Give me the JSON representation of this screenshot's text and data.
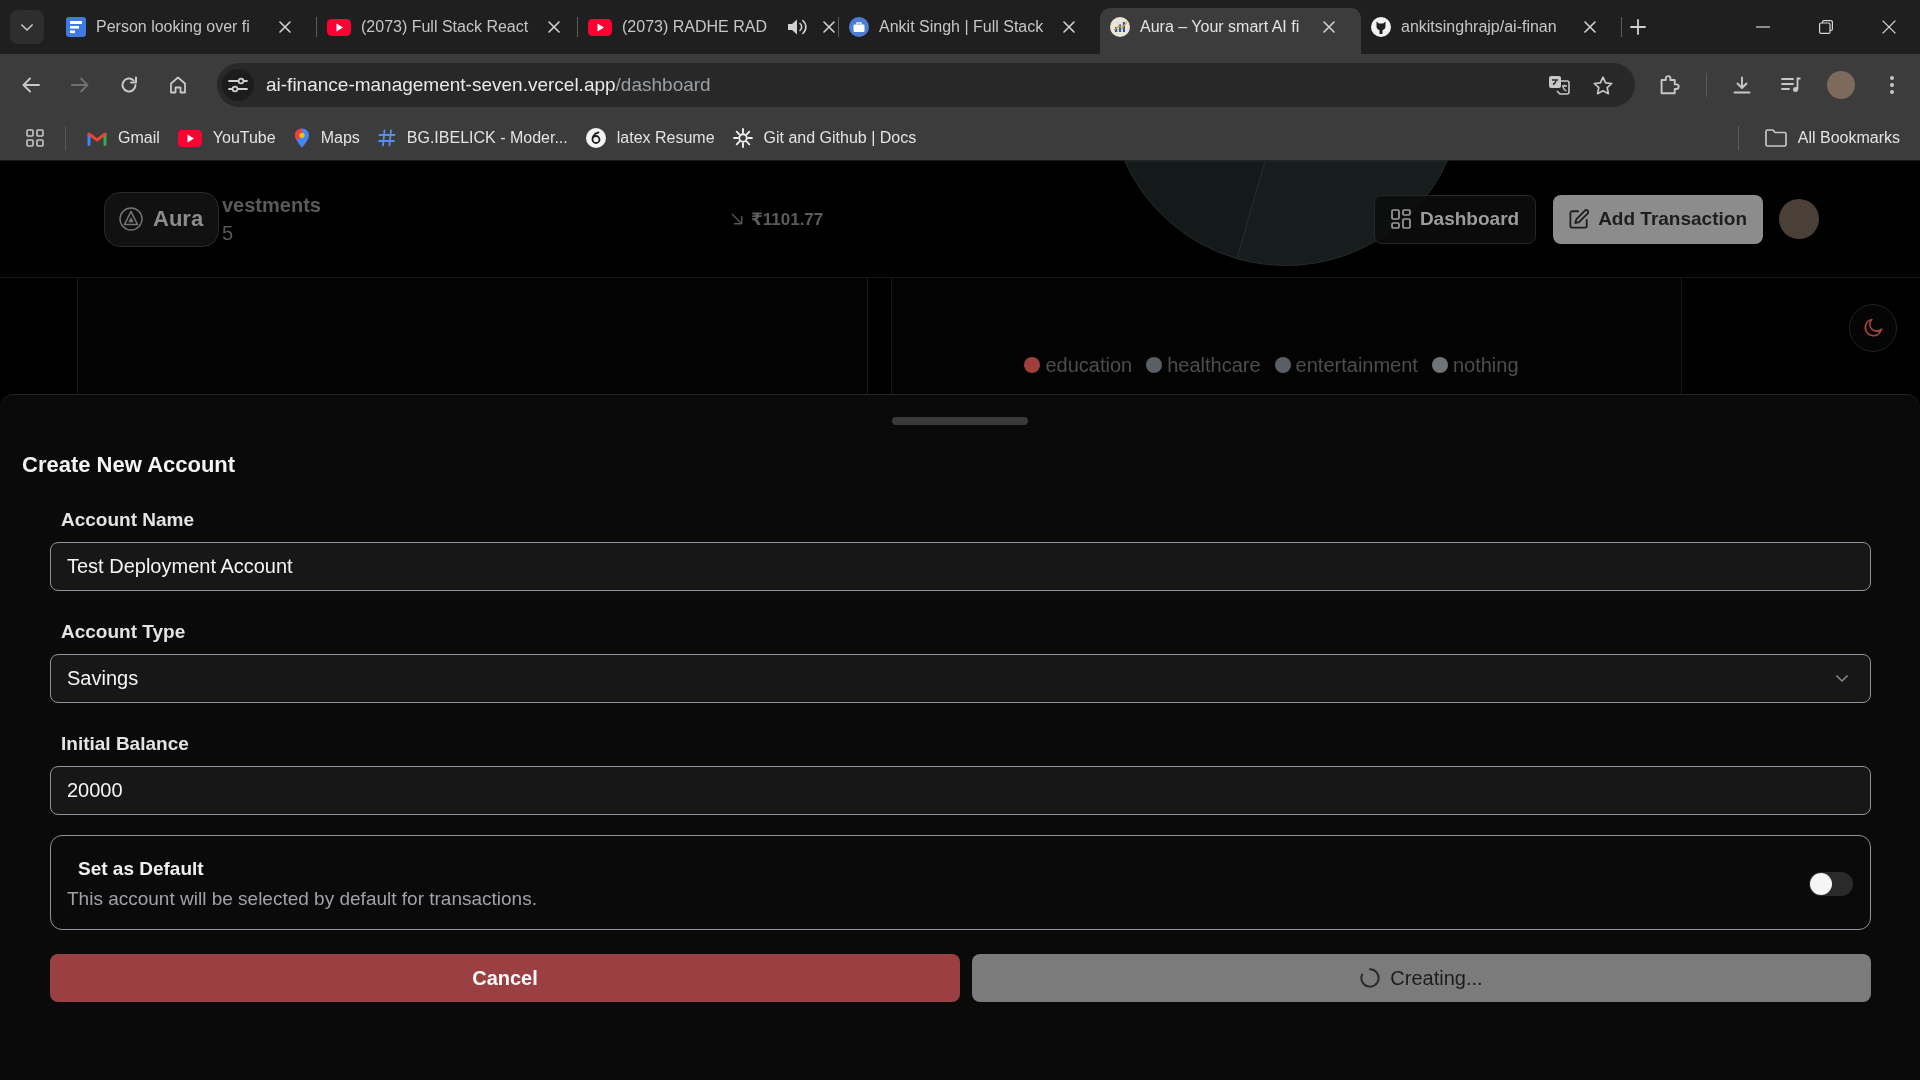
{
  "browser": {
    "tabs": [
      {
        "title": "Person looking over fi",
        "kind": "document",
        "selected": false,
        "audio": false
      },
      {
        "title": "(2073) Full Stack React",
        "kind": "video",
        "selected": false,
        "audio": false
      },
      {
        "title": "(2073) RADHE RAD",
        "kind": "video",
        "selected": false,
        "audio": true
      },
      {
        "title": "Ankit Singh | Full Stack",
        "kind": "briefcase",
        "selected": false,
        "audio": false
      },
      {
        "title": "Aura – Your smart AI fi",
        "kind": "chart",
        "selected": true,
        "audio": false
      },
      {
        "title": "ankitsinghrajp/ai-finan",
        "kind": "cat",
        "selected": false,
        "audio": false
      }
    ],
    "forward_disabled": true,
    "address": {
      "host": "ai-finance-management-seven.vercel.app",
      "path": "/dashboard"
    },
    "bookmarks": [
      {
        "label": "Gmail",
        "kind": "mail"
      },
      {
        "label": "YouTube",
        "kind": "video"
      },
      {
        "label": "Maps",
        "kind": "pin"
      },
      {
        "label": "BG.IBELICK - Moder...",
        "kind": "hash"
      },
      {
        "label": "latex Resume",
        "kind": "swirl"
      },
      {
        "label": "Git and Github | Docs",
        "kind": "burst"
      }
    ],
    "all_bookmarks": "All Bookmarks"
  },
  "header": {
    "logo": "Aura",
    "nav": [
      {
        "label": "Dashboard",
        "kind": "outline"
      },
      {
        "label": "Add Transaction",
        "kind": "filled"
      }
    ]
  },
  "backdrop": {
    "card_title": "vestments",
    "card_value": "5",
    "amount": "₹1101.77",
    "legend": [
      {
        "label": "education",
        "color": "#9e3f3b"
      },
      {
        "label": "healthcare",
        "color": "#5a5e65"
      },
      {
        "label": "entertainment",
        "color": "#5a5e65"
      },
      {
        "label": "nothing",
        "color": "#6f7479"
      }
    ]
  },
  "drawer": {
    "title": "Create New Account",
    "fields": [
      {
        "label": "Account Name",
        "kind": "text",
        "value": "Test Deployment Account"
      },
      {
        "label": "Account Type",
        "kind": "select",
        "value": "Savings"
      },
      {
        "label": "Initial Balance",
        "kind": "text",
        "value": "20000"
      }
    ],
    "default_option": {
      "label": "Set as Default",
      "description": "This account will be selected by default for transactions.",
      "on": false
    },
    "buttons": [
      {
        "label": "Cancel",
        "kind": "cancel",
        "loading": false
      },
      {
        "label": "Creating...",
        "kind": "submit",
        "loading": true
      }
    ]
  }
}
